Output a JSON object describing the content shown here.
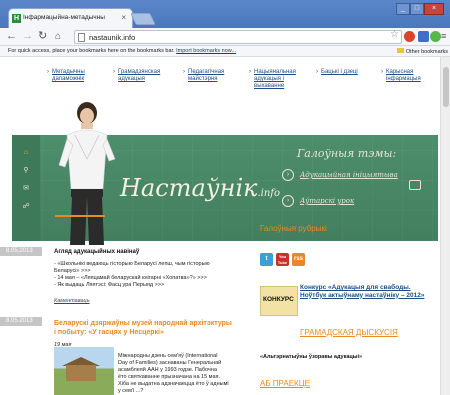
{
  "browser": {
    "tab_title": "Інфармацыйна-метадычны",
    "tab_close": "×",
    "url": "nastaunik.info",
    "back_icon": "back-arrow-icon",
    "bookmarks_hint": "For quick access, place your bookmarks here on the bookmarks bar.",
    "import_link": "Import bookmarks now...",
    "other_bookmarks": "Other bookmarks",
    "window_buttons": [
      "_",
      "□",
      "×"
    ]
  },
  "site": {
    "nav": [
      "Метадычны дапаможнік",
      "Грамадзянская адукацыя",
      "Педагагічная майстэрня",
      "Нацыянальная адукацыя і выхаванне",
      "Бацькі і дзеці",
      "Карысная інфармацыя"
    ],
    "logo_text": "Настаўнік",
    "logo_suffix": ".info",
    "hot_topics_title": "Галоўныя тэмы:",
    "hot_topics": [
      "Адукацыйная ініцыятыва",
      "Аўтарскі урок"
    ]
  },
  "articles": [
    {
      "date": "8.05.2013",
      "title": "Агляд адукацыйных навінаў",
      "lines": [
        "- «Школьнікі ведаюць гісторыю Беларусі лепш, чым гісторыю",
        "Беларусі» >>>",
        "- 14 мая – «Ляяцамай беларускай кнігарні «Хопатва»?» >>>",
        "- Як выдаць Ляятэсі: Фасц ура Перыяд >>>"
      ],
      "link": "Каментаваць"
    },
    {
      "date": "8.05.2013",
      "title": "Беларускі дзяржаўны музей народнай архітэктуры і побыту: «У гасцях у Несцеркі»",
      "byline": "19 мая",
      "lines": [
        "Міжнародны дзень сем'яў (International",
        "Day of Families) заснаваны Генеральнай",
        "асамблеяй ААН у 1993 годзе. Пабочна",
        "ёто святкаванне прызначана на 15 мая.",
        "Хіба не выдатна адзначаецца ёто ў аднымі",
        "у сем'і ...?"
      ]
    }
  ],
  "right": {
    "rubrics_title": "Галоўныя рубрыкі",
    "social": [
      "t",
      "You Tube",
      "rss"
    ],
    "konkurs_img_text": "КОНКУРС",
    "konkurs_link": "Конкурс «Адукацыя для свабоды. Ноўтбук актыўнаму настаўніку – 2012»",
    "dyskusia": "ГРАМАДСКАЯ ДЫСКУСІЯ",
    "altern": "«Альтэрнатыўны ўзоравы адукацыі»",
    "abpraekce": "АБ ПРАЕКЦЕ"
  },
  "colors": {
    "accent": "#e88a20",
    "board": "#4a8a6a",
    "link": "#1c4e8a"
  }
}
